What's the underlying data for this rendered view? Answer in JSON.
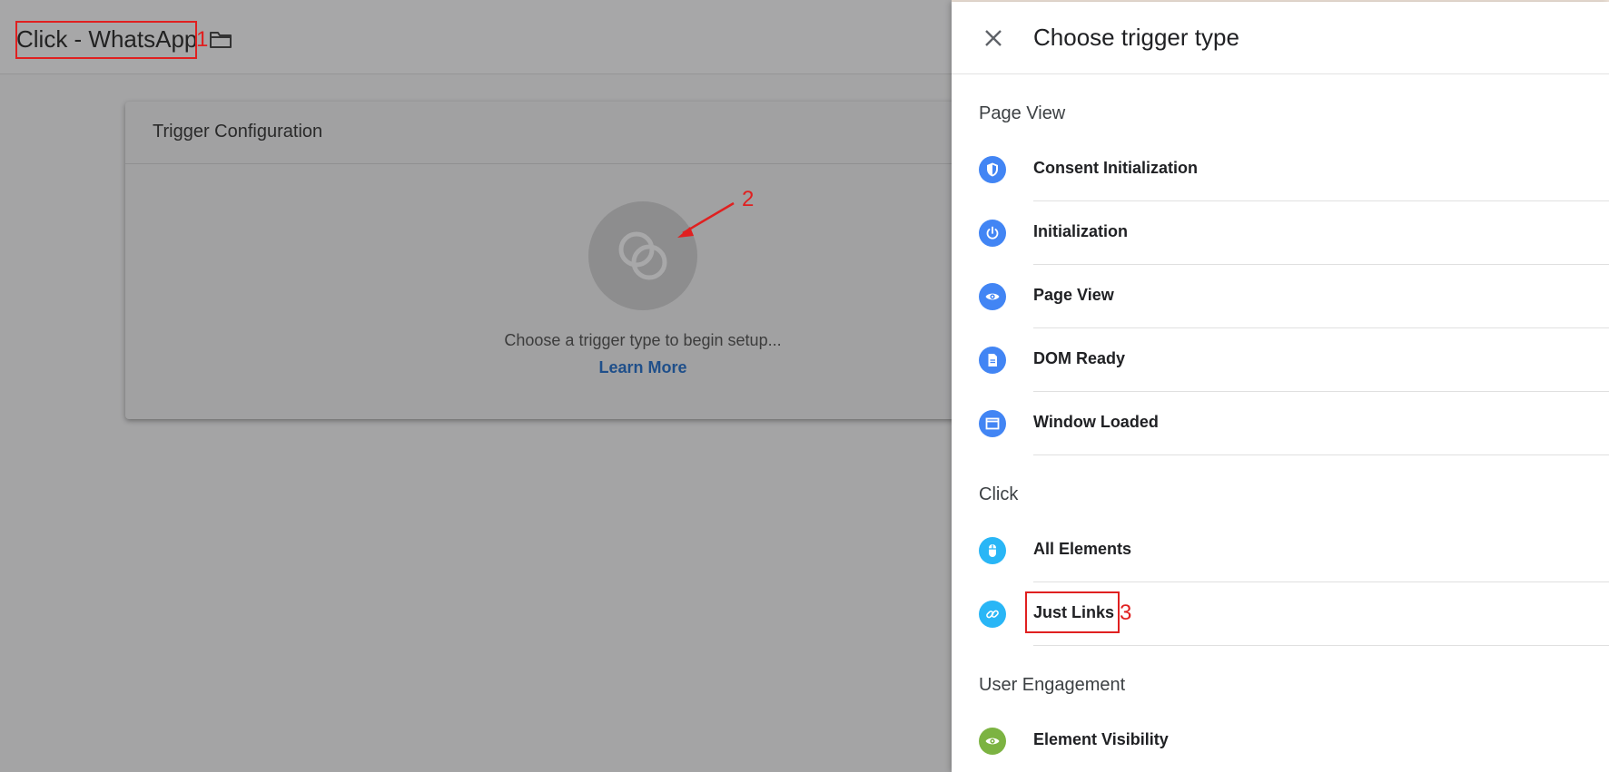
{
  "editor": {
    "trigger_name": "Click - WhatsApp",
    "card": {
      "title": "Trigger Configuration",
      "prompt": "Choose a trigger type to begin setup...",
      "link": "Learn More"
    }
  },
  "panel": {
    "title": "Choose trigger type",
    "sections": [
      {
        "label": "Page View",
        "items": [
          {
            "label": "Consent Initialization",
            "icon": "shield-icon",
            "color": "#4285f4"
          },
          {
            "label": "Initialization",
            "icon": "power-icon",
            "color": "#4285f4"
          },
          {
            "label": "Page View",
            "icon": "eye-icon",
            "color": "#4285f4"
          },
          {
            "label": "DOM Ready",
            "icon": "document-icon",
            "color": "#4285f4"
          },
          {
            "label": "Window Loaded",
            "icon": "window-icon",
            "color": "#4285f4"
          }
        ]
      },
      {
        "label": "Click",
        "items": [
          {
            "label": "All Elements",
            "icon": "mouse-icon",
            "color": "#29b6f6"
          },
          {
            "label": "Just Links",
            "icon": "link-icon",
            "color": "#29b6f6"
          }
        ]
      },
      {
        "label": "User Engagement",
        "items": [
          {
            "label": "Element Visibility",
            "icon": "eye-icon",
            "color": "#7cb342"
          }
        ]
      }
    ]
  },
  "annotations": [
    "1",
    "2",
    "3"
  ],
  "colors": {
    "annotation": "#e02020",
    "accent": "#4285f4"
  }
}
